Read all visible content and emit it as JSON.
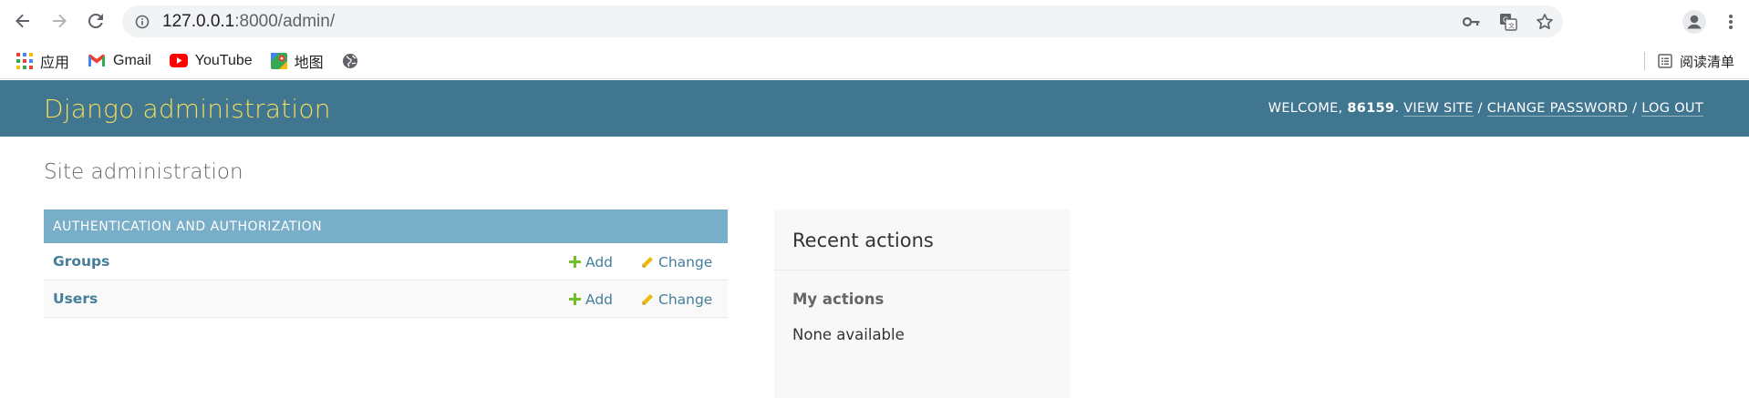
{
  "browser": {
    "url_host": "127.0.0.1",
    "url_rest": ":8000/admin/",
    "bookmarks": [
      {
        "label": "应用",
        "icon": "apps-grid-icon"
      },
      {
        "label": "Gmail",
        "icon": "gmail-icon"
      },
      {
        "label": "YouTube",
        "icon": "youtube-icon"
      },
      {
        "label": "地图",
        "icon": "maps-icon"
      },
      {
        "label": "",
        "icon": "globe-icon"
      }
    ],
    "reading_list": "阅读清单"
  },
  "header": {
    "branding": "Django administration",
    "welcome": "Welcome,",
    "username": "86159",
    "view_site": "View site",
    "change_password": "Change password",
    "log_out": "Log out"
  },
  "content": {
    "page_title": "Site administration",
    "module": {
      "caption": "Authentication and Authorization",
      "rows": [
        {
          "name": "Groups",
          "add": "Add",
          "change": "Change"
        },
        {
          "name": "Users",
          "add": "Add",
          "change": "Change"
        }
      ]
    },
    "recent": {
      "title": "Recent actions",
      "my_actions": "My actions",
      "empty": "None available"
    }
  },
  "colors": {
    "header_bg": "#417690",
    "branding": "#f5dd5d",
    "caption_bg": "#79aec8",
    "link": "#447e9b",
    "add_icon": "#70bf2b",
    "change_icon": "#efb80b"
  }
}
